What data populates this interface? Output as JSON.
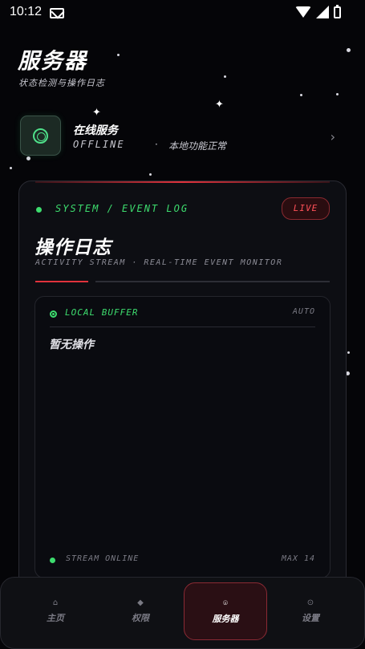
{
  "status_bar": {
    "time": "10:12"
  },
  "header": {
    "title": "服务器",
    "subtitle": "状态检测与操作日志"
  },
  "service": {
    "name": "在线服务",
    "state": "OFFLINE",
    "separator": "·",
    "note": "本地功能正常",
    "icon": "ring-icon"
  },
  "log_card": {
    "section_label": "SYSTEM / EVENT LOG",
    "live_badge": "LIVE",
    "title": "操作日志",
    "stream_text": "ACTIVITY STREAM  ·  REAL-TIME EVENT MONITOR",
    "buffer": {
      "label": "LOCAL BUFFER",
      "mode": "AUTO",
      "empty_text": "暂无操作",
      "footer_status": "STREAM ONLINE",
      "footer_max": "MAX 14"
    }
  },
  "nav": {
    "items": [
      {
        "label": "主页",
        "icon": "home-icon",
        "glyph": "⌂",
        "active": false
      },
      {
        "label": "权限",
        "icon": "diamond-icon",
        "glyph": "◆",
        "active": false
      },
      {
        "label": "服务器",
        "icon": "server-icon",
        "glyph": "⌾",
        "active": true
      },
      {
        "label": "设置",
        "icon": "gear-icon",
        "glyph": "⊙",
        "active": false
      }
    ]
  },
  "colors": {
    "accent_green": "#3ddc6e",
    "accent_red": "#e0323c",
    "background": "#050508"
  }
}
